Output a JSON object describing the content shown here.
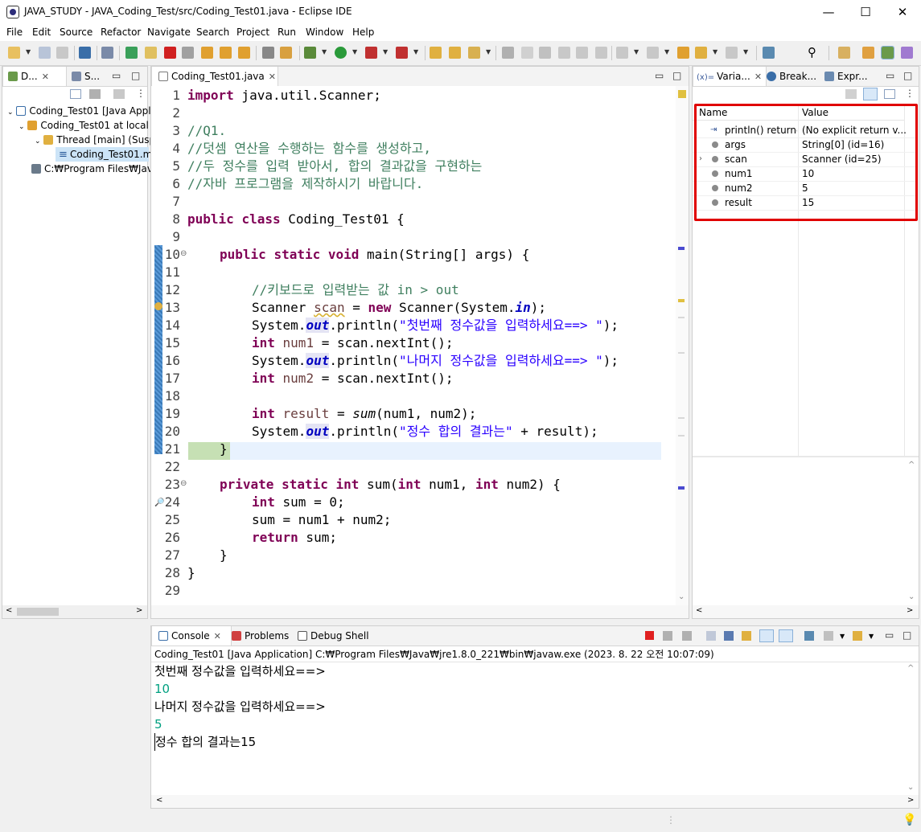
{
  "window": {
    "title": "JAVA_STUDY - JAVA_Coding_Test/src/Coding_Test01.java - Eclipse IDE",
    "minimize": "—",
    "maximize": "☐",
    "close": "✕"
  },
  "menu": [
    "File",
    "Edit",
    "Source",
    "Refactor",
    "Navigate",
    "Search",
    "Project",
    "Run",
    "Window",
    "Help"
  ],
  "debug_panel": {
    "tabs": [
      {
        "label": "D..."
      },
      {
        "label": "S..."
      }
    ],
    "tree": [
      {
        "label": "Coding_Test01 [Java Appl"
      },
      {
        "label": "Coding_Test01 at local"
      },
      {
        "label": "Thread [main] (Susp"
      },
      {
        "label": "Coding_Test01.m"
      },
      {
        "label": "C:₩Program Files₩Java"
      }
    ]
  },
  "editor": {
    "tab_label": "Coding_Test01.java",
    "line_numbers": [
      "1",
      "2",
      "3",
      "4",
      "5",
      "6",
      "7",
      "8",
      "9",
      "10",
      "11",
      "12",
      "13",
      "14",
      "15",
      "16",
      "17",
      "18",
      "19",
      "20",
      "21",
      "22",
      "23",
      "24",
      "25",
      "26",
      "27",
      "28",
      "29"
    ],
    "code": {
      "l1_kw": "import",
      "l1_rest": " java.util.Scanner;",
      "l3": "//Q1.",
      "l4": "//덧셈 연산을 수행하는 함수를 생성하고,",
      "l5": "//두 정수를 입력 받아서, 합의 결과값을 구현하는",
      "l6": "//자바 프로그램을 제작하시기 바랍니다.",
      "l8_kw1": "public",
      "l8_kw2": "class",
      "l8_rest": " Coding_Test01 {",
      "l10_kw1": "public",
      "l10_kw2": "static",
      "l10_kw3": "void",
      "l10_rest": " main(String[] args) {",
      "l12": "//키보드로 입력받는 값 in > out",
      "l13_a": "Scanner ",
      "l13_var": "scan",
      "l13_b": " = ",
      "l13_kw": "new",
      "l13_c": " Scanner(System.",
      "l13_fld": "in",
      "l13_d": ");",
      "sys": "System.",
      "out": "out",
      "println": ".println(",
      "l14_str": "\"첫번째 정수값을 입력하세요==> \"",
      "l14_end": ");",
      "int": "int",
      "l15_var": " num1",
      "l15_rest": " = scan.nextInt();",
      "l16_str": "\"나머지 정수값을 입력하세요==> \"",
      "l16_end": ");",
      "l17_var": " num2",
      "l17_rest": " = scan.nextInt();",
      "l19_var": " result",
      "l19_a": " = ",
      "l19_fn": "sum",
      "l19_b": "(num1, num2);",
      "l20_str": "\"정수 합의 결과는\"",
      "l20_end": " + result);",
      "l21": "}",
      "l23_kw1": "private",
      "l23_kw2": "static",
      "l23_kw3": "int",
      "l23_a": " sum(",
      "l23_kw4": "int",
      "l23_b": " num1, ",
      "l23_kw5": "int",
      "l23_c": " num2) {",
      "l24_rest": " sum = 0;",
      "l25": "sum = num1 + num2;",
      "l26_kw": "return",
      "l26_rest": " sum;",
      "l27": "}",
      "l28": "}"
    }
  },
  "variables_panel": {
    "tabs": [
      {
        "label": "Varia..."
      },
      {
        "label": "Break..."
      },
      {
        "label": "Expr..."
      }
    ],
    "col_name": "Name",
    "col_value": "Value",
    "rows": [
      {
        "name": "println() returned",
        "value": "(No explicit return v..."
      },
      {
        "name": "args",
        "value": "String[0]  (id=16)"
      },
      {
        "name": "scan",
        "value": "Scanner  (id=25)"
      },
      {
        "name": "num1",
        "value": "10"
      },
      {
        "name": "num2",
        "value": "5"
      },
      {
        "name": "result",
        "value": "15"
      }
    ],
    "highlight_color": "#e00000"
  },
  "console_panel": {
    "tabs": [
      {
        "label": "Console"
      },
      {
        "label": "Problems"
      },
      {
        "label": "Debug Shell"
      }
    ],
    "header": "Coding_Test01 [Java Application] C:₩Program Files₩Java₩jre1.8.0_221₩bin₩javaw.exe  (2023. 8. 22 오전 10:07:09)",
    "lines": [
      "첫번째 정수값을 입력하세요==>",
      "10",
      "나머지 정수값을 입력하세요==>",
      "5",
      "정수 합의 결과는15"
    ]
  }
}
